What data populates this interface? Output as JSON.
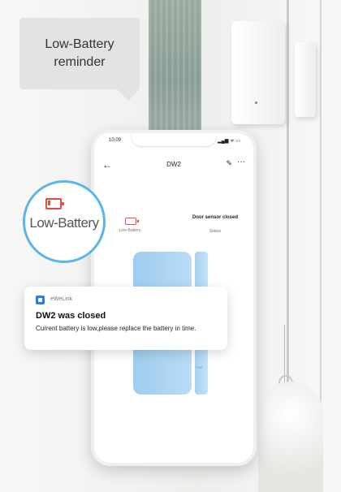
{
  "bubble": {
    "line1": "Low-Battery",
    "line2": "reminder"
  },
  "phone": {
    "status_time": "10:09",
    "status_icons": "▂▄▆ ᯤ ▭",
    "back": "←",
    "title": "DW2",
    "edit": "✎",
    "more": "···",
    "battery_label": "Low-Battery",
    "door_status": "Door sensor closed",
    "status_label": "Status",
    "sensor_caption": "TCW"
  },
  "callout": {
    "label": "Low-Battery"
  },
  "notification": {
    "app_name": "eWeLink",
    "title": "DW2 was closed",
    "body": "Current battery is low,please replace the battery in time."
  },
  "colors": {
    "accent": "#5ab6e8",
    "battery_red": "#e34a43",
    "sensor_blue": "#a8d2f1"
  },
  "icons": [
    "back-arrow-icon",
    "edit-icon",
    "more-icon",
    "battery-low-icon",
    "app-icon"
  ]
}
